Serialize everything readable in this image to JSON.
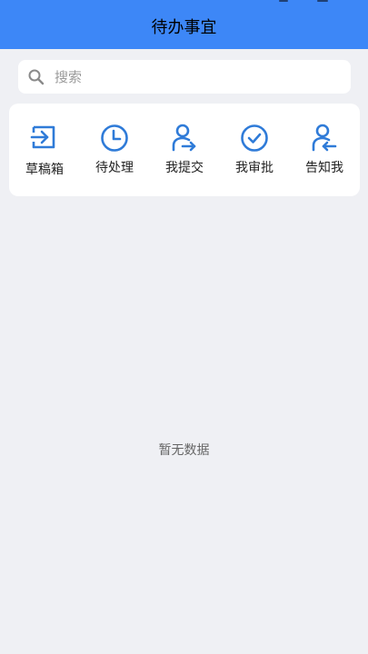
{
  "header": {
    "title": "待办事宜"
  },
  "search": {
    "placeholder": "搜索",
    "value": ""
  },
  "quick_actions": [
    {
      "label": "草稿箱",
      "icon": "inbox-arrow-icon"
    },
    {
      "label": "待处理",
      "icon": "clock-icon"
    },
    {
      "label": "我提交",
      "icon": "user-arrow-right-icon"
    },
    {
      "label": "我审批",
      "icon": "check-circle-icon"
    },
    {
      "label": "告知我",
      "icon": "user-arrow-left-icon"
    }
  ],
  "empty_state": {
    "text": "暂无数据"
  },
  "colors": {
    "header_bg": "#3d87f7",
    "icon_blue": "#2f7bd8",
    "page_bg": "#eff0f4"
  }
}
